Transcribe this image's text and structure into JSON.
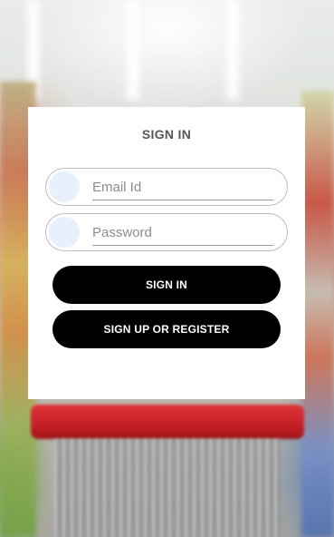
{
  "screen": {
    "title": "SIGN IN"
  },
  "form": {
    "email": {
      "value": "",
      "placeholder": "Email Id"
    },
    "password": {
      "value": "",
      "placeholder": "Password"
    }
  },
  "actions": {
    "sign_in_label": "SIGN IN",
    "sign_up_label": "SIGN UP OR REGISTER"
  },
  "icons": {
    "email": "user-avatar-icon",
    "password": "lock-avatar-icon"
  },
  "colors": {
    "button_bg": "#000000",
    "button_text": "#ffffff",
    "card_bg": "#ffffff",
    "title_text": "#555555",
    "icon_circle": "#e8f1fb",
    "cart_handle": "#c51f25"
  }
}
